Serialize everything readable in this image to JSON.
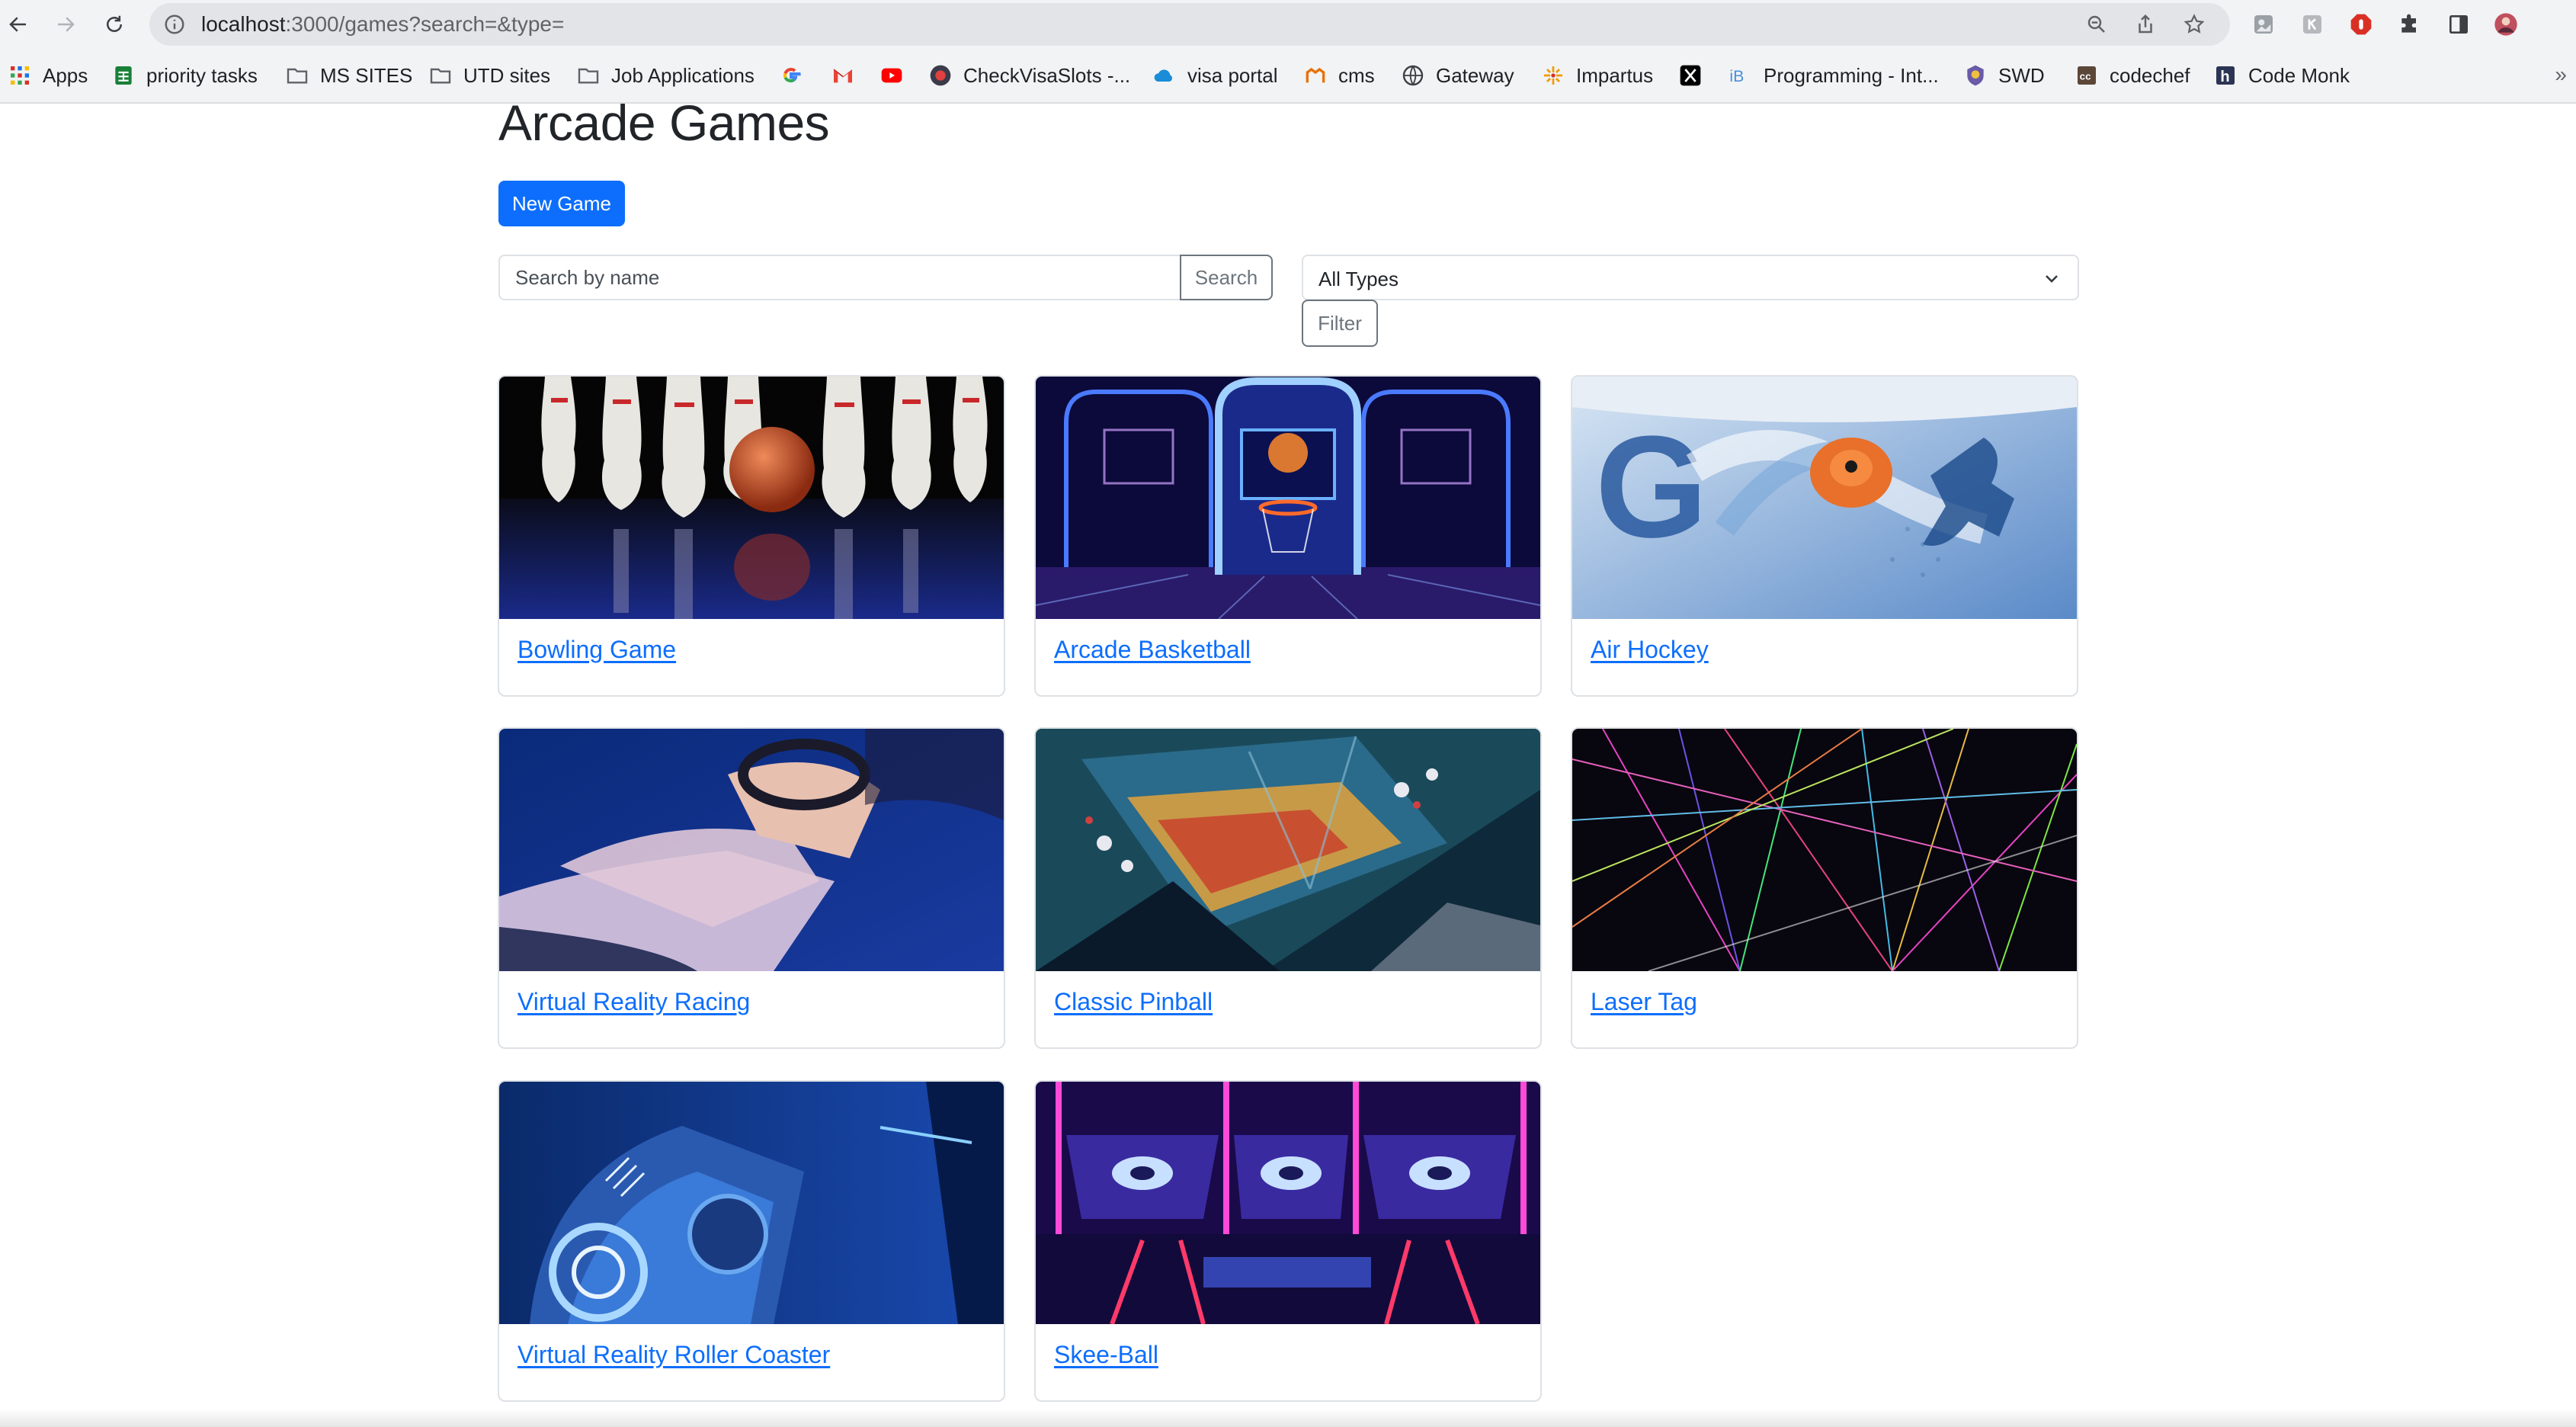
{
  "browser": {
    "url_host": "localhost",
    "url_rest": ":3000/games?search=&type=",
    "bookmarks": [
      {
        "label": "Apps",
        "icon": "apps-grid-icon"
      },
      {
        "label": "priority tasks",
        "icon": "sheets-icon"
      },
      {
        "label": "MS SITES",
        "icon": "folder-icon"
      },
      {
        "label": "UTD sites",
        "icon": "folder-icon"
      },
      {
        "label": "Job Applications",
        "icon": "folder-icon"
      },
      {
        "label": "",
        "icon": "google-icon"
      },
      {
        "label": "",
        "icon": "gmail-icon"
      },
      {
        "label": "",
        "icon": "youtube-icon"
      },
      {
        "label": "CheckVisaSlots -...",
        "icon": "checkvisaslots-icon"
      },
      {
        "label": "visa portal",
        "icon": "cloud-icon"
      },
      {
        "label": "cms",
        "icon": "cms-icon"
      },
      {
        "label": "Gateway",
        "icon": "globe-icon"
      },
      {
        "label": "Impartus",
        "icon": "impartus-icon"
      },
      {
        "label": "",
        "icon": "x-icon"
      },
      {
        "label": "Programming - Int...",
        "icon": "interviewbit-icon"
      },
      {
        "label": "SWD",
        "icon": "swd-icon"
      },
      {
        "label": "codechef",
        "icon": "codechef-icon"
      },
      {
        "label": "Code Monk",
        "icon": "hackerearth-icon"
      }
    ],
    "more_label": "»"
  },
  "page": {
    "title": "Arcade Games",
    "new_game_label": "New Game",
    "search": {
      "placeholder": "Search by name",
      "value": "",
      "button_label": "Search"
    },
    "type_filter": {
      "selected": "All Types",
      "button_label": "Filter"
    }
  },
  "games": [
    {
      "title": "Bowling Game",
      "image": "bowling-pins-photo"
    },
    {
      "title": "Arcade Basketball",
      "image": "arcade-basketball-photo"
    },
    {
      "title": "Air Hockey",
      "image": "air-hockey-photo"
    },
    {
      "title": "Virtual Reality Racing",
      "image": "vr-racing-photo"
    },
    {
      "title": "Classic Pinball",
      "image": "pinball-photo"
    },
    {
      "title": "Laser Tag",
      "image": "laser-lights-photo"
    },
    {
      "title": "Virtual Reality Roller Coaster",
      "image": "vr-coaster-photo"
    },
    {
      "title": "Skee-Ball",
      "image": "skee-ball-photo"
    }
  ],
  "colors": {
    "primary": "#0d6efd",
    "link": "#0d6efd",
    "secondary": "#6c757d",
    "border": "#dee2e6"
  }
}
